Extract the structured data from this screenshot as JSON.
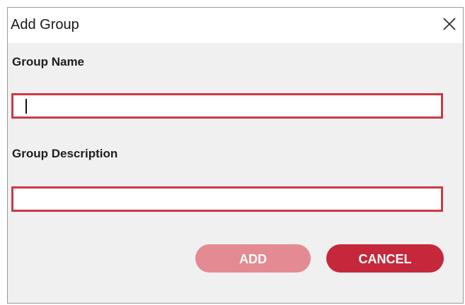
{
  "dialog": {
    "title": "Add Group",
    "close_icon": "close-icon"
  },
  "form": {
    "group_name_label": "Group Name",
    "group_name_value": "",
    "group_description_label": "Group Description",
    "group_description_value": ""
  },
  "buttons": {
    "add_label": "ADD",
    "add_enabled": false,
    "cancel_label": "CANCEL"
  },
  "colors": {
    "accent": "#c5283b",
    "accent_disabled": "#e48a92",
    "input_border": "#c93a45"
  }
}
